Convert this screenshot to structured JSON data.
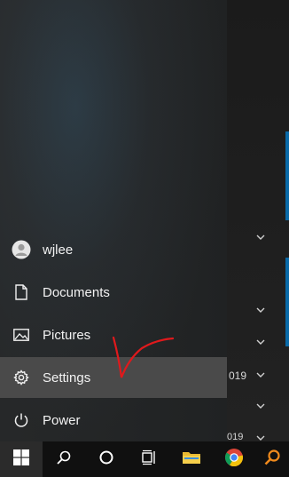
{
  "start_menu": {
    "user_name": "wjlee",
    "items": {
      "documents": "Documents",
      "pictures": "Pictures",
      "settings": "Settings",
      "power": "Power"
    }
  },
  "background": {
    "text_2019_a": "019",
    "text_2019_b": "019"
  },
  "taskbar": {
    "icons": [
      "windows-start-icon",
      "search-icon",
      "cortana-icon",
      "task-view-icon",
      "file-explorer-icon",
      "chrome-icon",
      "search-orange-icon"
    ]
  },
  "colors": {
    "accent_blue": "#0a6aa8",
    "annotation_red": "#e0191c",
    "settings_highlight": "#4a4a4a"
  }
}
